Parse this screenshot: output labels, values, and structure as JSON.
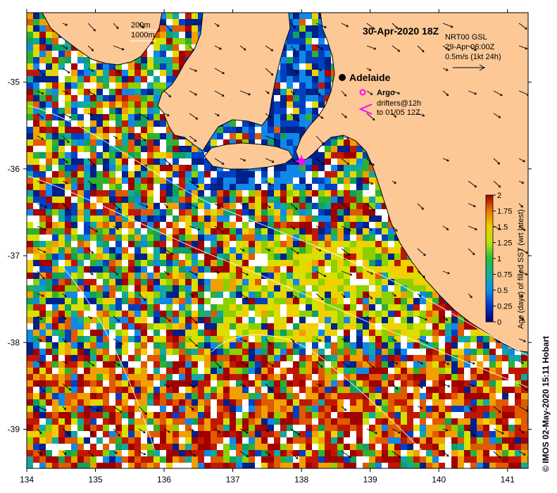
{
  "title": "30-Apr-2020 18Z",
  "credit": "© IMOS 02-May-2020 15:11 Hobart",
  "depth_legend": {
    "contour_a": "200m",
    "contour_b": "1000m"
  },
  "current_legend": {
    "line1": "NRT00 GSL",
    "line2": "29-Apr 06:00Z",
    "line3": "0.5m/s (1kt 24h)"
  },
  "adelaide_label": "Adelaide",
  "argo_label": "Argo",
  "drifters_line1": "drifters@12h",
  "drifters_line2": "to 01/05 12Z",
  "colorbar": {
    "label": "Age (days) of filled SST (wrt latest)",
    "ticks": [
      "0",
      "0.25",
      "0.5",
      "0.75",
      "1",
      "1.25",
      "1.5",
      "1.75",
      "2"
    ],
    "range": [
      0,
      2
    ]
  },
  "axes": {
    "x_ticks": [
      "134",
      "135",
      "136",
      "137",
      "138",
      "139",
      "140",
      "141"
    ],
    "y_ticks": [
      "-35",
      "-36",
      "-37",
      "-38",
      "-39"
    ],
    "x_range": [
      134,
      141.3
    ],
    "y_range": [
      -39.45,
      -34.2
    ]
  },
  "colors": {
    "land": "#fbc896",
    "marker": "#ff00ff"
  }
}
